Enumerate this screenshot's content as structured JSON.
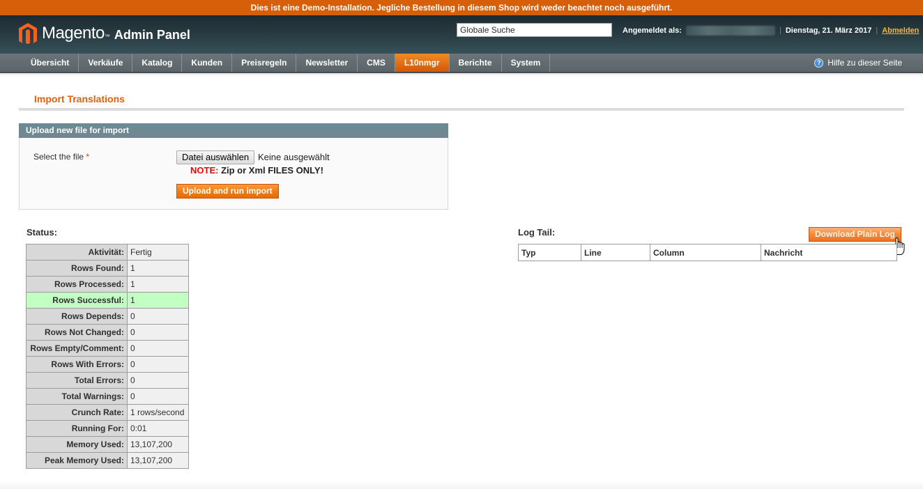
{
  "banner": {
    "text": "Dies ist eine Demo-Installation. Jegliche Bestellung in diesem Shop wird weder beachtet noch ausgeführt."
  },
  "header": {
    "logo_word": "Magento",
    "logo_tm": "™",
    "logo_suffix": "Admin Panel",
    "search_value": "Globale Suche",
    "logged_in_label": "Angemeldet als:",
    "date": "Dienstag, 21. März 2017",
    "logout_label": "Abmelden",
    "separator": "|"
  },
  "nav": {
    "items": [
      {
        "label": "Übersicht",
        "active": false
      },
      {
        "label": "Verkäufe",
        "active": false
      },
      {
        "label": "Katalog",
        "active": false
      },
      {
        "label": "Kunden",
        "active": false
      },
      {
        "label": "Preisregeln",
        "active": false
      },
      {
        "label": "Newsletter",
        "active": false
      },
      {
        "label": "CMS",
        "active": false
      },
      {
        "label": "L10nmgr",
        "active": true
      },
      {
        "label": "Berichte",
        "active": false
      },
      {
        "label": "System",
        "active": false
      }
    ],
    "help_label": "Hilfe zu dieser Seite",
    "help_icon": "?"
  },
  "page": {
    "title": "Import Translations"
  },
  "upload": {
    "section_title": "Upload new file for import",
    "field_label": "Select the file",
    "required_mark": "*",
    "file_button_label": "Datei auswählen",
    "file_status": "Keine ausgewählt",
    "note_prefix": "NOTE:",
    "note_text": " Zip or Xml FILES ONLY!",
    "submit_label": "Upload and run import"
  },
  "status": {
    "label": "Status:",
    "rows": [
      {
        "key": "Aktivität:",
        "value": "Fertig"
      },
      {
        "key": "Rows Found:",
        "value": "1"
      },
      {
        "key": "Rows Processed:",
        "value": "1"
      },
      {
        "key": "Rows Successful:",
        "value": "1"
      },
      {
        "key": "Rows Depends:",
        "value": "0"
      },
      {
        "key": "Rows Not Changed:",
        "value": "0"
      },
      {
        "key": "Rows Empty/Comment:",
        "value": "0"
      },
      {
        "key": "Rows With Errors:",
        "value": "0"
      },
      {
        "key": "Total Errors:",
        "value": "0"
      },
      {
        "key": "Total Warnings:",
        "value": "0"
      },
      {
        "key": "Crunch Rate:",
        "value": "1 rows/second"
      },
      {
        "key": "Running For:",
        "value": "0:01"
      },
      {
        "key": "Memory Used:",
        "value": "13,107,200"
      },
      {
        "key": "Peak Memory Used:",
        "value": "13,107,200"
      }
    ]
  },
  "log": {
    "label": "Log Tail:",
    "download_label": "Download Plain Log",
    "columns": [
      "Typ",
      "Line",
      "Column",
      "Nachricht"
    ]
  },
  "colors": {
    "accent_orange": "#eb5e00",
    "banner_orange": "#d75f0a",
    "success_green": "#c2ffc2",
    "section_header": "#6f8992"
  }
}
